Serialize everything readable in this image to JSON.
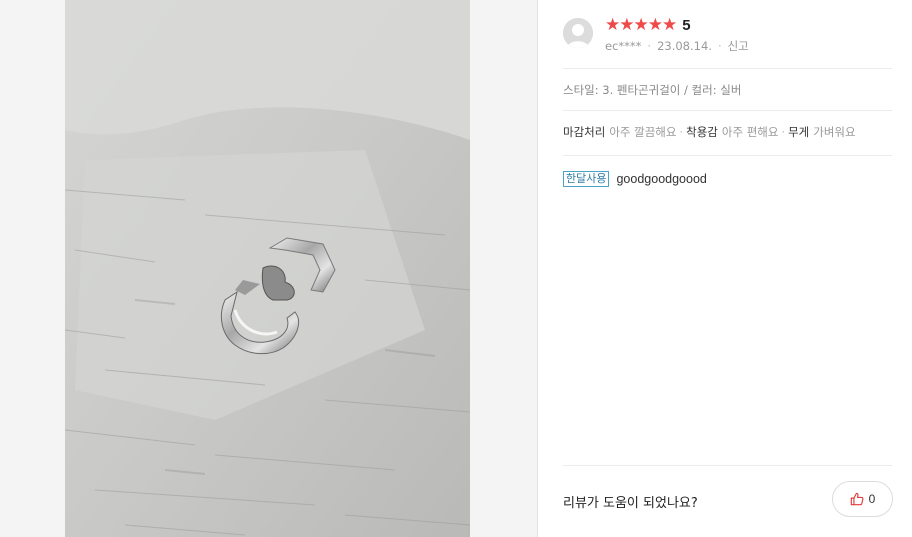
{
  "review": {
    "rating_stars": 5,
    "score": "5",
    "user": "ec****",
    "date": "23.08.14.",
    "report_label": "신고",
    "option": "스타일: 3. 펜타곤귀걸이 / 컬러: 실버",
    "attributes": [
      {
        "key": "마감처리",
        "value": "아주 깔끔해요"
      },
      {
        "key": "착용감",
        "value": "아주 편해요"
      },
      {
        "key": "무게",
        "value": "가벼워요"
      }
    ],
    "usage_badge": "한달사용",
    "body": "goodgoodgoood"
  },
  "helpful": {
    "question": "리뷰가 도움이 되었나요?",
    "count": "0"
  },
  "colors": {
    "star": "#ef4a4a",
    "badge_border": "#4aa3c7",
    "like_icon": "#e23b3b"
  },
  "icons": {
    "avatar": "default-user-avatar-icon",
    "like": "thumbs-up-icon"
  }
}
